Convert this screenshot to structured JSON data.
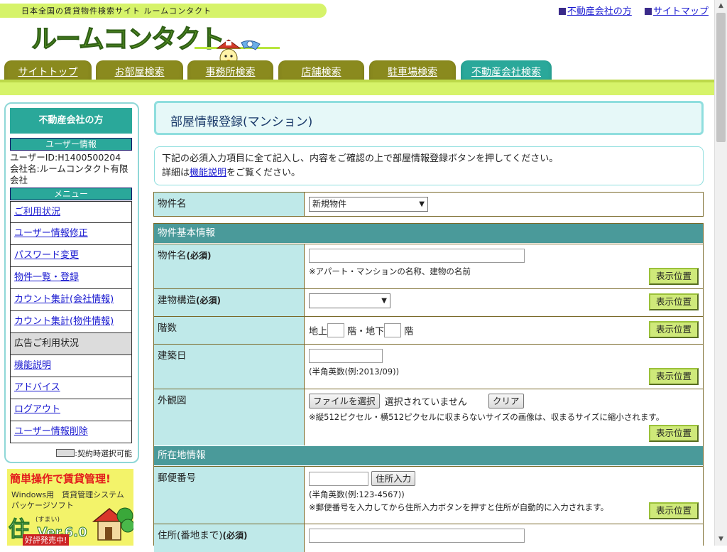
{
  "header": {
    "tagline": "日本全国の賃貸物件検索サイト ルームコンタクト",
    "logo_text": "ルームコンタクト",
    "links": [
      "不動産会社の方",
      "サイトマップ"
    ]
  },
  "nav": {
    "tabs": [
      "サイトトップ",
      "お部屋検索",
      "事務所検索",
      "店舗検索",
      "駐車場検索",
      "不動産会社検索"
    ],
    "active_tab": "不動産会社検索"
  },
  "sidebar": {
    "heading": "不動産会社の方",
    "user_section": "ユーザー情報",
    "user_id": "ユーザーID:H1400500204",
    "company": "会社名:ルームコンタクト有限会社",
    "menu_section": "メニュー",
    "menu": [
      {
        "label": "ご利用状況",
        "link": true
      },
      {
        "label": "ユーザー情報修正",
        "link": true
      },
      {
        "label": "パスワード変更",
        "link": true
      },
      {
        "label": "物件一覧・登録",
        "link": true
      },
      {
        "label": "カウント集計(会社情報)",
        "link": true
      },
      {
        "label": "カウント集計(物件情報)",
        "link": true
      },
      {
        "label": "広告ご利用状況",
        "link": false
      },
      {
        "label": "機能説明",
        "link": true
      },
      {
        "label": "アドバイス",
        "link": true
      },
      {
        "label": "ログアウト",
        "link": true
      },
      {
        "label": "ユーザー情報削除",
        "link": true
      }
    ],
    "legend": ":契約時選択可能"
  },
  "banner": {
    "title": "簡単操作で賃貸管理!",
    "line1": "Windows用　賃貸管理システム",
    "line2": "パッケージソフト",
    "product": "住",
    "reading": "(すまい)",
    "version": "Ver.6.0",
    "release": "好評発売中!"
  },
  "main": {
    "title": "部屋情報登録(マンション)",
    "desc_line1": "下記の必須入力項目に全て記入し、内容をご確認の上で部屋情報登録ボタンを押してください。",
    "desc_prefix": "詳細は",
    "desc_link": "機能説明",
    "desc_suffix": "をご覧ください。"
  },
  "form": {
    "property_label": "物件名",
    "property_select": "新規物件",
    "basic_section": "物件基本情報",
    "name_label": "物件名",
    "required": "(必須)",
    "name_note": "※アパート・マンションの名称、建物の名前",
    "structure_label": "建物構造",
    "floors_label": "階数",
    "floors_above": "地上",
    "floors_mid": "階・地下",
    "floors_end": "階",
    "built_label": "建築日",
    "built_note": "(半角英数(例:2013/09))",
    "exterior_label": "外観図",
    "file_button": "ファイルを選択",
    "file_status": "選択されていません",
    "clear_button": "クリア",
    "exterior_note": "※縦512ピクセル・横512ピクセルに収まらないサイズの画像は、収まるサイズに縮小されます。",
    "location_section": "所在地情報",
    "postal_label": "郵便番号",
    "address_button": "住所入力",
    "postal_note1": "(半角英数(例:123-4567))",
    "postal_note2": "※郵便番号を入力してから住所入力ボタンを押すと住所が自動的に入力されます。",
    "address_label": "住所(番地まで)",
    "position_button": "表示位置"
  }
}
